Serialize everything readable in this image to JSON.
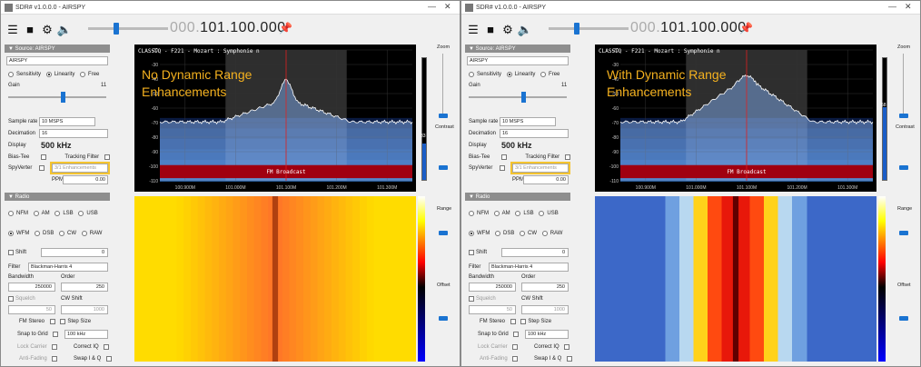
{
  "windows": [
    {
      "title": "SDR# v1.0.0.0 - AIRSPY",
      "toolbar": {
        "freq_dim": "000.",
        "freq_main": "101.100.000"
      },
      "source": {
        "header": "Source: AIRSPY",
        "device": "AIRSPY",
        "modes": [
          "Sensitivity",
          "Linearity",
          "Free"
        ],
        "gain_label": "Gain",
        "gain_value": "11",
        "sample_rate_label": "Sample rate",
        "sample_rate": "10 MSPS",
        "decimation_label": "Decimation",
        "decimation": "16",
        "display_label": "Display",
        "display_value": "500 kHz",
        "biastee_label": "Bias-Tee",
        "tracking_label": "Tracking Filter",
        "spyverter_label": "SpyVerter",
        "enhancement": "3/1 Enhancements",
        "ppm_label": "PPM",
        "ppm_value": "0.00"
      },
      "radio": {
        "header": "Radio",
        "modes_row1": [
          "NFM",
          "AM",
          "LSB",
          "USB"
        ],
        "modes_row2": [
          "WFM",
          "DSB",
          "CW",
          "RAW"
        ],
        "shift_label": "Shift",
        "shift_value": "0",
        "filter_label": "Filter",
        "filter_value": "Blackman-Harris 4",
        "bandwidth_label": "Bandwidth",
        "order_label": "Order",
        "bandwidth_value": "250000",
        "order_value": "250",
        "squelch_label": "Squelch",
        "cwshift_label": "CW Shift",
        "squelch_value": "50",
        "cwshift_value": "1000",
        "fmstereo_label": "FM Stereo",
        "stepsize_label": "Step Size",
        "snap_label": "Snap to Grid",
        "snap_value": "100 kHz",
        "lockcarrier_label": "Lock Carrier",
        "correctiq_label": "Correct IQ",
        "antifading_label": "Anti-Fading",
        "swapiq_label": "Swap I & Q"
      },
      "spectrum": {
        "station": "CLASSIQ  - F221 - Mozart : Symphonie n",
        "broadcast": "FM Broadcast",
        "yticks": [
          "-20",
          "-30",
          "-40",
          "-50",
          "-60",
          "-70",
          "-80",
          "-90",
          "-100",
          "-110"
        ],
        "xticks": [
          "100.900M",
          "101.000M",
          "101.100M",
          "101.200M",
          "101.300M"
        ],
        "level_value": "33"
      },
      "right": {
        "zoom": "Zoom",
        "contrast": "Contrast",
        "range": "Range",
        "offset": "Offset"
      },
      "overlay": {
        "line1": "No Dynamic Range",
        "line2": "Enhancements"
      }
    },
    {
      "title": "SDR# v1.0.0.0 - AIRSPY",
      "toolbar": {
        "freq_dim": "000.",
        "freq_main": "101.100.000"
      },
      "source": {
        "header": "Source: AIRSPY",
        "device": "AIRSPY",
        "modes": [
          "Sensitivity",
          "Linearity",
          "Free"
        ],
        "gain_label": "Gain",
        "gain_value": "11",
        "sample_rate_label": "Sample rate",
        "sample_rate": "10 MSPS",
        "decimation_label": "Decimation",
        "decimation": "16",
        "display_label": "Display",
        "display_value": "500 kHz",
        "biastee_label": "Bias-Tee",
        "tracking_label": "Tracking Filter",
        "spyverter_label": "SpyVerter",
        "enhancement": "3/1 Enhancements",
        "ppm_label": "PPM",
        "ppm_value": "0.00"
      },
      "radio": {
        "header": "Radio",
        "modes_row1": [
          "NFM",
          "AM",
          "LSB",
          "USB"
        ],
        "modes_row2": [
          "WFM",
          "DSB",
          "CW",
          "RAW"
        ],
        "shift_label": "Shift",
        "shift_value": "0",
        "filter_label": "Filter",
        "filter_value": "Blackman-Harris 4",
        "bandwidth_label": "Bandwidth",
        "order_label": "Order",
        "bandwidth_value": "250000",
        "order_value": "250",
        "squelch_label": "Squelch",
        "cwshift_label": "CW Shift",
        "squelch_value": "50",
        "cwshift_value": "1000",
        "fmstereo_label": "FM Stereo",
        "stepsize_label": "Step Size",
        "snap_label": "Snap to Grid",
        "snap_value": "100 kHz",
        "lockcarrier_label": "Lock Carrier",
        "correctiq_label": "Correct IQ",
        "antifading_label": "Anti-Fading",
        "swapiq_label": "Swap I & Q"
      },
      "spectrum": {
        "station": "CLASSIQ  - F221 - Mozart : Symphonie n",
        "broadcast": "FM Broadcast",
        "yticks": [
          "-20",
          "-30",
          "-40",
          "-50",
          "-60",
          "-70",
          "-80",
          "-90",
          "-100",
          "-110"
        ],
        "xticks": [
          "100.900M",
          "101.000M",
          "101.100M",
          "101.200M",
          "101.300M"
        ],
        "level_value": "58"
      },
      "right": {
        "zoom": "Zoom",
        "contrast": "Contrast",
        "range": "Range",
        "offset": "Offset"
      },
      "overlay": {
        "line1": "With Dynamic Range",
        "line2": "Enhancements"
      }
    }
  ],
  "colors": {
    "accent": "#1a73d1",
    "overlay_text": "#f4b11f",
    "highlight_box": "#f4c430",
    "broadcast_band": "#a00010"
  }
}
